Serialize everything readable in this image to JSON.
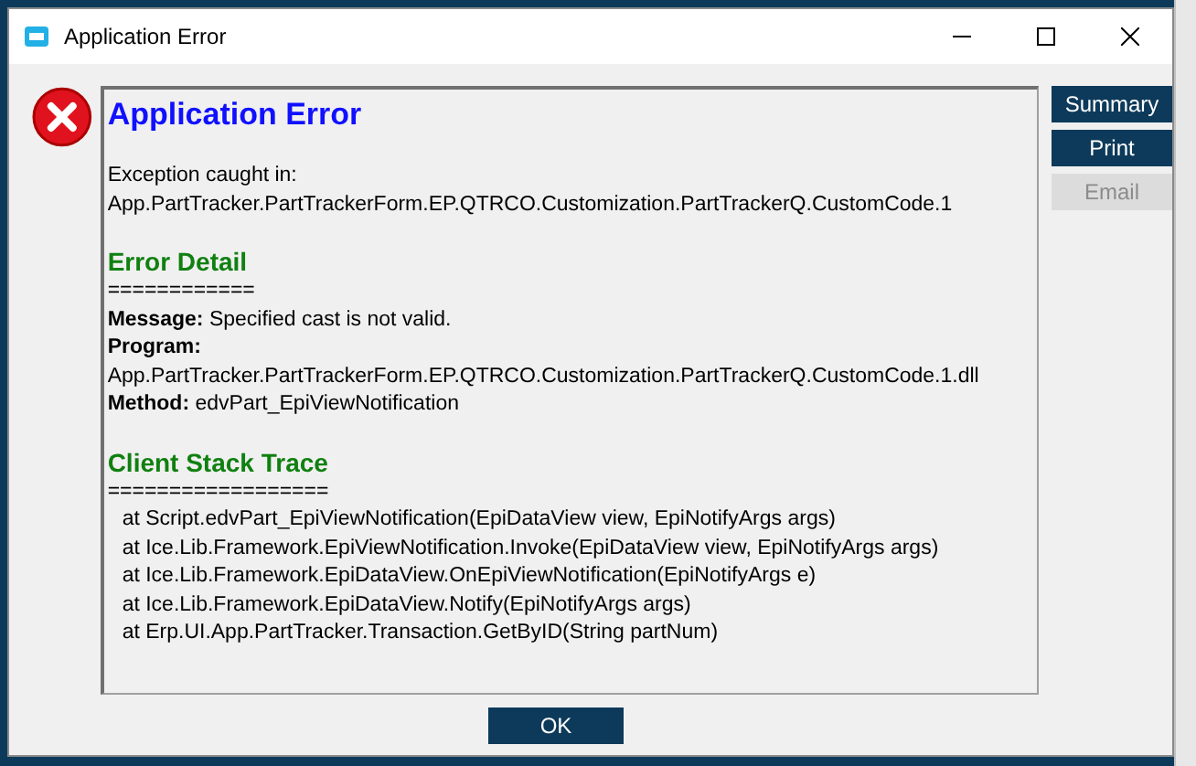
{
  "window": {
    "title": "Application Error"
  },
  "report": [
    {
      "kind": "title",
      "text": "Application Error"
    },
    {
      "kind": "text",
      "text": "Exception caught in:"
    },
    {
      "kind": "text",
      "text": "App.PartTracker.PartTrackerForm.EP.QTRCO.Customization.PartTrackerQ.CustomCode.1"
    },
    {
      "kind": "heading",
      "text": "Error Detail"
    },
    {
      "kind": "text",
      "text": "============"
    },
    {
      "kind": "field",
      "label": "Message:",
      "text": "Specified cast is not valid."
    },
    {
      "kind": "label",
      "text": "Program:"
    },
    {
      "kind": "text",
      "text": "App.PartTracker.PartTrackerForm.EP.QTRCO.Customization.PartTrackerQ.CustomCode.1.dll"
    },
    {
      "kind": "field",
      "label": "Method:",
      "text": "edvPart_EpiViewNotification"
    },
    {
      "kind": "heading",
      "text": "Client Stack Trace"
    },
    {
      "kind": "text",
      "text": "=================="
    },
    {
      "kind": "trace",
      "text": "at Script.edvPart_EpiViewNotification(EpiDataView view, EpiNotifyArgs args)"
    },
    {
      "kind": "trace",
      "text": "at Ice.Lib.Framework.EpiViewNotification.Invoke(EpiDataView view, EpiNotifyArgs args)"
    },
    {
      "kind": "trace",
      "text": "at Ice.Lib.Framework.EpiDataView.OnEpiViewNotification(EpiNotifyArgs e)"
    },
    {
      "kind": "trace",
      "text": "at Ice.Lib.Framework.EpiDataView.Notify(EpiNotifyArgs args)"
    },
    {
      "kind": "trace",
      "text": "at Erp.UI.App.PartTracker.Transaction.GetByID(String partNum)"
    }
  ],
  "side_buttons": [
    {
      "label": "Summary",
      "disabled": false
    },
    {
      "label": "Print",
      "disabled": false
    },
    {
      "label": "Email",
      "disabled": true
    }
  ],
  "ok_button": {
    "label": "OK"
  }
}
